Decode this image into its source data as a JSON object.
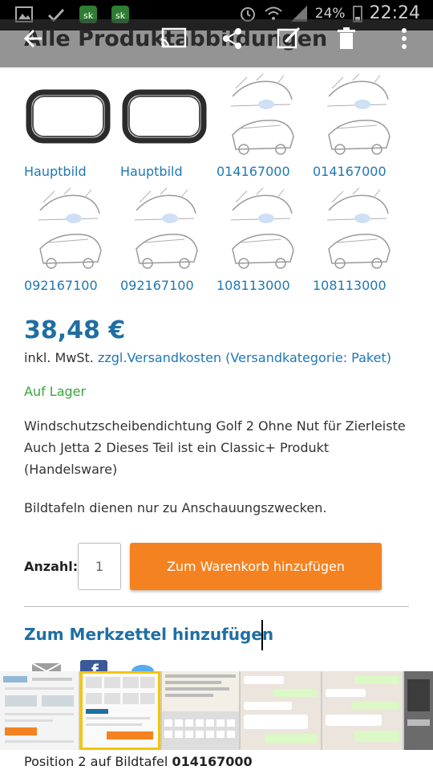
{
  "status_bar": {
    "battery": "24%",
    "time": "22:24"
  },
  "toolbar": {
    "title": "Alle Produktabbildungen",
    "icons": [
      "back-arrow-icon",
      "cast-icon",
      "share-icon",
      "edit-icon",
      "delete-icon",
      "more-icon"
    ]
  },
  "thumbnails": [
    {
      "label": "Hauptbild",
      "kind": "seal"
    },
    {
      "label": "Hauptbild",
      "kind": "seal"
    },
    {
      "label": "014167000",
      "kind": "diagram"
    },
    {
      "label": "014167000",
      "kind": "diagram"
    },
    {
      "label": "092167100",
      "kind": "diagram"
    },
    {
      "label": "092167100",
      "kind": "diagram"
    },
    {
      "label": "108113000",
      "kind": "diagram"
    },
    {
      "label": "108113000",
      "kind": "diagram"
    }
  ],
  "product": {
    "price": "38,48 €",
    "tax_text": "inkl. MwSt.",
    "shipping_link": "zzgl.Versandkosten (Versandkategorie: Paket)",
    "stock": "Auf Lager",
    "description": "Windschutzscheibendichtung Golf 2 Ohne Nut für Zierleiste Auch Jetta 2 Dieses Teil ist ein Classic+ Produkt (Handelsware)",
    "note": "Bildtafeln dienen nur zu Anschauungszwecken.",
    "quantity_label": "Anzahl:",
    "quantity_value": "1",
    "cart_button": "Zum Warenkorb hinzufügen",
    "memo_link": "Zum Merkzettel hinzufügen"
  },
  "bottom_caption": {
    "prefix": "Position 2 auf Bildtafel",
    "number": "014167000"
  },
  "colors": {
    "link": "#1f77b4",
    "price": "#1e6fa3",
    "stock": "#3aa63a",
    "button": "#f58220"
  }
}
